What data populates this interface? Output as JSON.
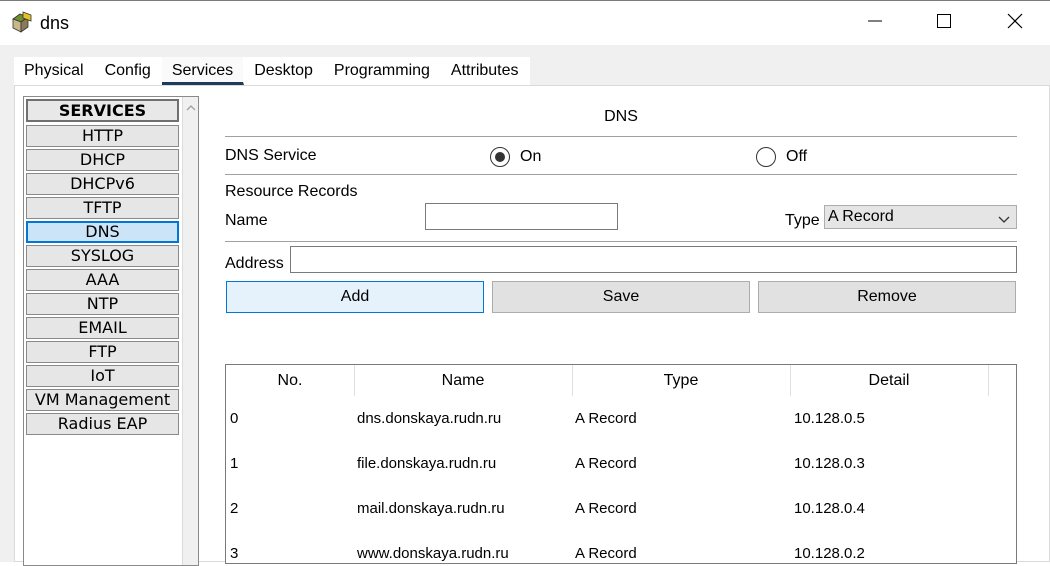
{
  "window": {
    "title": "dns"
  },
  "tabs": [
    "Physical",
    "Config",
    "Services",
    "Desktop",
    "Programming",
    "Attributes"
  ],
  "services": {
    "header": "SERVICES",
    "items": [
      "HTTP",
      "DHCP",
      "DHCPv6",
      "TFTP",
      "DNS",
      "SYSLOG",
      "AAA",
      "NTP",
      "EMAIL",
      "FTP",
      "IoT",
      "VM Management",
      "Radius EAP"
    ],
    "selected": "DNS"
  },
  "dns": {
    "title": "DNS",
    "service_label": "DNS Service",
    "on_label": "On",
    "off_label": "Off",
    "resource_records_label": "Resource Records",
    "name_label": "Name",
    "name_value": "",
    "type_label": "Type",
    "type_value": "A Record",
    "address_label": "Address",
    "address_value": "",
    "add_label": "Add",
    "save_label": "Save",
    "remove_label": "Remove"
  },
  "records": {
    "columns": [
      "No.",
      "Name",
      "Type",
      "Detail"
    ],
    "rows": [
      [
        "0",
        "dns.donskaya.rudn.ru",
        "A Record",
        "10.128.0.5"
      ],
      [
        "1",
        "file.donskaya.rudn.ru",
        "A Record",
        "10.128.0.3"
      ],
      [
        "2",
        "mail.donskaya.rudn.ru",
        "A Record",
        "10.128.0.4"
      ],
      [
        "3",
        "www.donskaya.rudn.ru",
        "A Record",
        "10.128.0.2"
      ]
    ]
  }
}
